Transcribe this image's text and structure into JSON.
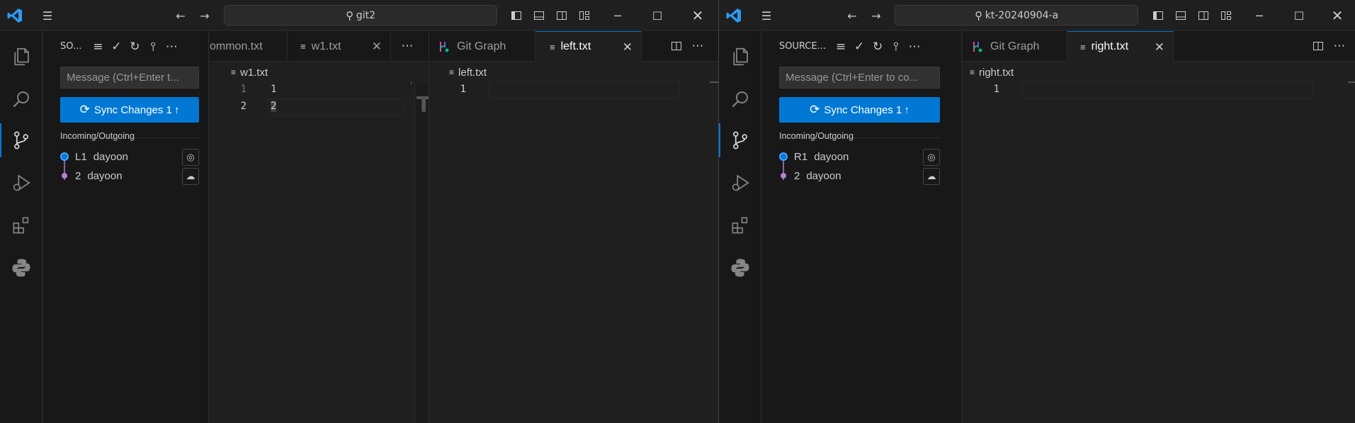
{
  "left_window": {
    "search": "git2",
    "sidebar": {
      "title": "SO...",
      "message_placeholder": "Message (Ctrl+Enter t...",
      "sync_label": "Sync Changes 1",
      "section_label": "Incoming/Outgoing",
      "commits": [
        {
          "id": "L1",
          "author": "dayoon"
        },
        {
          "id": "2",
          "author": "dayoon"
        }
      ]
    },
    "group1": {
      "tabs": [
        {
          "label": "ommon.txt"
        },
        {
          "label": "w1.txt"
        }
      ],
      "breadcrumb": "w1.txt",
      "lines": [
        {
          "no": "1",
          "text": "1"
        },
        {
          "no": "2",
          "text": "2"
        }
      ]
    },
    "group2": {
      "tabs": [
        {
          "label": "Git Graph"
        },
        {
          "label": "left.txt"
        }
      ],
      "breadcrumb": "left.txt",
      "lines": [
        {
          "no": "1",
          "text": ""
        }
      ]
    }
  },
  "right_window": {
    "search": "kt-20240904-a",
    "sidebar": {
      "title": "SOURCE...",
      "message_placeholder": "Message (Ctrl+Enter to co...",
      "sync_label": "Sync Changes 1",
      "section_label": "Incoming/Outgoing",
      "commits": [
        {
          "id": "R1",
          "author": "dayoon"
        },
        {
          "id": "2",
          "author": "dayoon"
        }
      ]
    },
    "group1": {
      "tabs": [
        {
          "label": "Git Graph"
        },
        {
          "label": "right.txt"
        }
      ],
      "breadcrumb": "right.txt",
      "lines": [
        {
          "no": "1",
          "text": ""
        }
      ]
    }
  },
  "colors": {
    "accent": "#0078d4",
    "commit_outgoing": "#0078d4",
    "commit_incoming": "#b180d7"
  }
}
